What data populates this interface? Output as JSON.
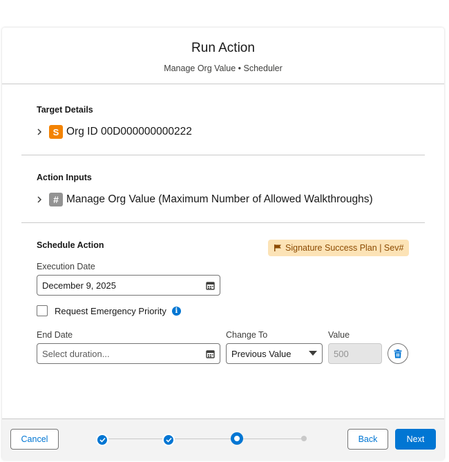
{
  "header": {
    "title": "Run Action",
    "subtitle": "Manage Org Value • Scheduler"
  },
  "target": {
    "section_title": "Target Details",
    "badge": "S",
    "label": "Org ID 00D000000000222"
  },
  "inputs": {
    "section_title": "Action Inputs",
    "badge": "#",
    "label": "Manage Org Value (Maximum Number of Allowed Walkthroughs)"
  },
  "schedule": {
    "section_title": "Schedule Action",
    "plan_badge": "Signature Success Plan | Sev#",
    "execution_date_label": "Execution Date",
    "execution_date_value": "December 9, 2025",
    "emergency_label": "Request Emergency Priority",
    "emergency_checked": false,
    "end_date_label": "End Date",
    "end_date_placeholder": "Select duration...",
    "change_to_label": "Change To",
    "change_to_value": "Previous Value",
    "value_label": "Value",
    "value_value": "500"
  },
  "footer": {
    "cancel_label": "Cancel",
    "back_label": "Back",
    "next_label": "Next",
    "progress": {
      "total_steps": 4,
      "current_step": 3
    }
  },
  "colors": {
    "brand": "#0176d3",
    "badge_orange": "#f38303",
    "plan_badge_bg": "#fce3b6",
    "plan_badge_text": "#8c4b02"
  },
  "icons": {
    "expand": "chevron-right-icon",
    "calendar": "calendar-icon",
    "info": "info-icon",
    "delete": "trash-icon",
    "flag": "flag-icon",
    "dropdown": "caret-down-icon",
    "step_done": "check-icon"
  }
}
